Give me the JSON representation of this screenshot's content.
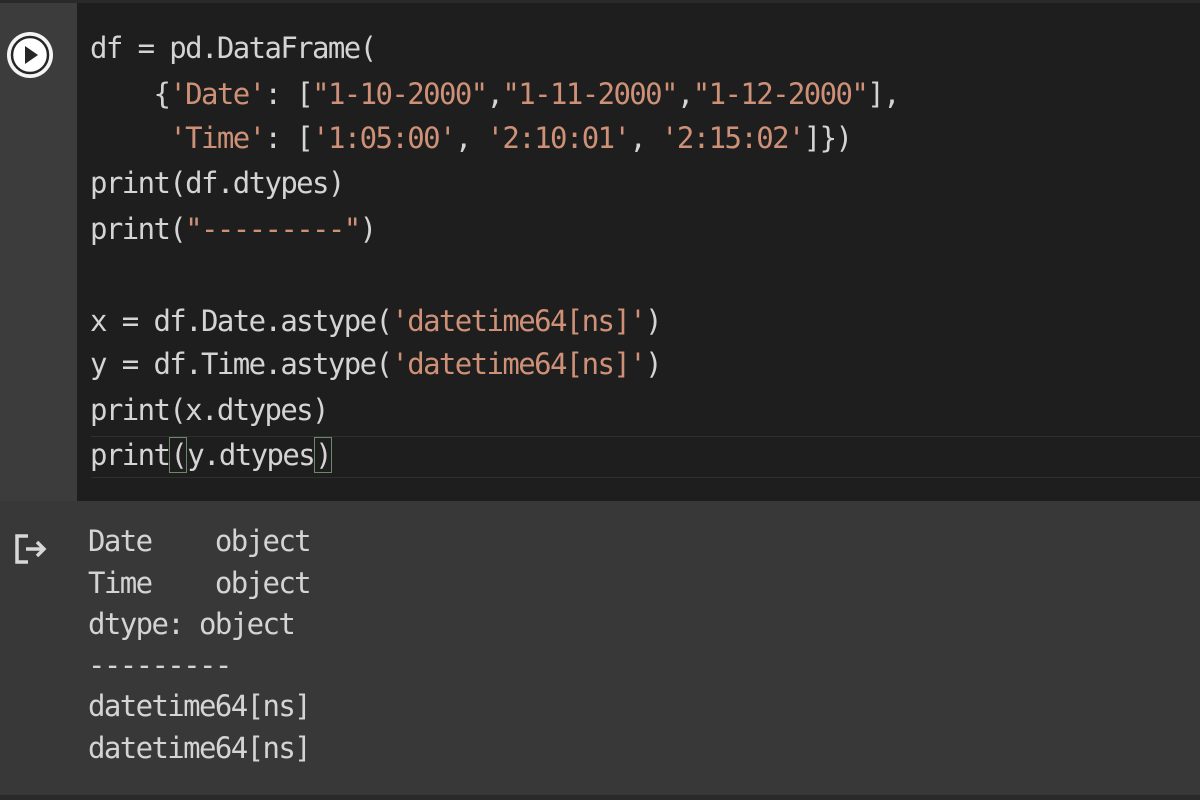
{
  "code_cell": {
    "lines": [
      [
        {
          "t": "df = pd.DataFrame("
        }
      ],
      [
        {
          "t": "    {"
        },
        {
          "t": "'Date'",
          "c": "str"
        },
        {
          "t": ": ["
        },
        {
          "t": "\"1-10-2000\"",
          "c": "str"
        },
        {
          "t": ","
        },
        {
          "t": "\"1-11-2000\"",
          "c": "str"
        },
        {
          "t": ","
        },
        {
          "t": "\"1-12-2000\"",
          "c": "str"
        },
        {
          "t": "],"
        }
      ],
      [
        {
          "t": "     "
        },
        {
          "t": "'Time'",
          "c": "str"
        },
        {
          "t": ": ["
        },
        {
          "t": "'1:05:00'",
          "c": "str"
        },
        {
          "t": ", "
        },
        {
          "t": "'2:10:01'",
          "c": "str"
        },
        {
          "t": ", "
        },
        {
          "t": "'2:15:02'",
          "c": "str"
        },
        {
          "t": "]})"
        }
      ],
      [
        {
          "t": "print(df.dtypes)"
        }
      ],
      [
        {
          "t": "print("
        },
        {
          "t": "\"---------\"",
          "c": "str"
        },
        {
          "t": ")"
        }
      ],
      [
        {
          "t": ""
        }
      ],
      [
        {
          "t": "x = df.Date.astype("
        },
        {
          "t": "'datetime64[ns]'",
          "c": "str"
        },
        {
          "t": ")"
        }
      ],
      [
        {
          "t": "y = df.Time.astype("
        },
        {
          "t": "'datetime64[ns]'",
          "c": "str"
        },
        {
          "t": ")"
        }
      ],
      [
        {
          "t": "print(x.dtypes)"
        }
      ],
      [
        {
          "t": "print"
        },
        {
          "t": "(",
          "c": "bm"
        },
        {
          "t": "y.dtypes"
        },
        {
          "t": ")",
          "c": "bm"
        }
      ]
    ]
  },
  "output": {
    "lines": [
      "Date    object",
      "Time    object",
      "dtype: object",
      "---------",
      "datetime64[ns]",
      "datetime64[ns]"
    ]
  },
  "icons": {
    "run": "play-icon",
    "output": "output-redirect-icon"
  },
  "colors": {
    "editor_bg": "#1e1e1e",
    "gutter_bg": "#3c3c3c",
    "output_bg": "#383838",
    "code_text": "#d4d4d4",
    "string": "#ce9178"
  }
}
